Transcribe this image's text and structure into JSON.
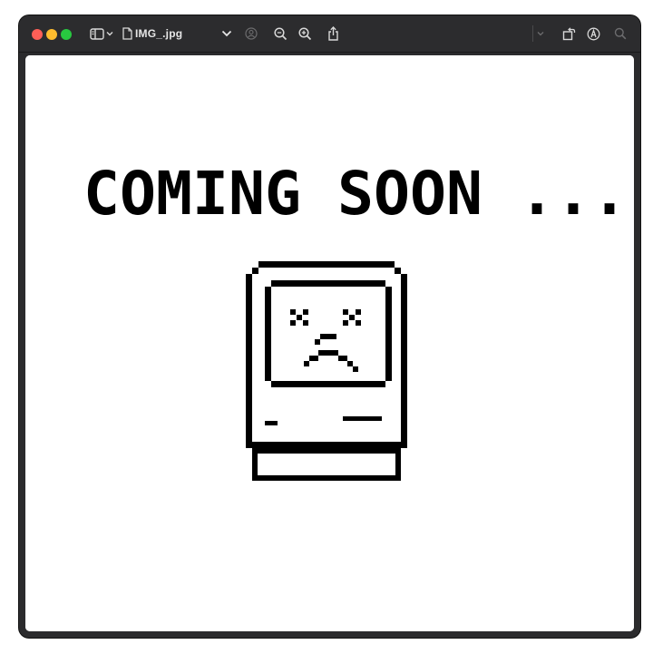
{
  "window": {
    "document_title": "IMG_.jpg",
    "traffic_lights": {
      "close": "#ff5f57",
      "minimize": "#febc2e",
      "zoom": "#28c840"
    }
  },
  "toolbar": {
    "icons": [
      "sidebar-toggle-icon",
      "chevron-down-icon",
      "document-icon",
      "title-menu-chevron-icon",
      "person-circle-icon",
      "zoom-out-icon",
      "zoom-in-icon",
      "share-icon",
      "toolbar-chevron-icon",
      "rotate-icon",
      "markup-icon",
      "search-icon"
    ]
  },
  "image": {
    "headline": "COMING SOON ...",
    "illustration": "sad-mac-icon",
    "ink_color": "#000000",
    "background_color": "#ffffff"
  }
}
